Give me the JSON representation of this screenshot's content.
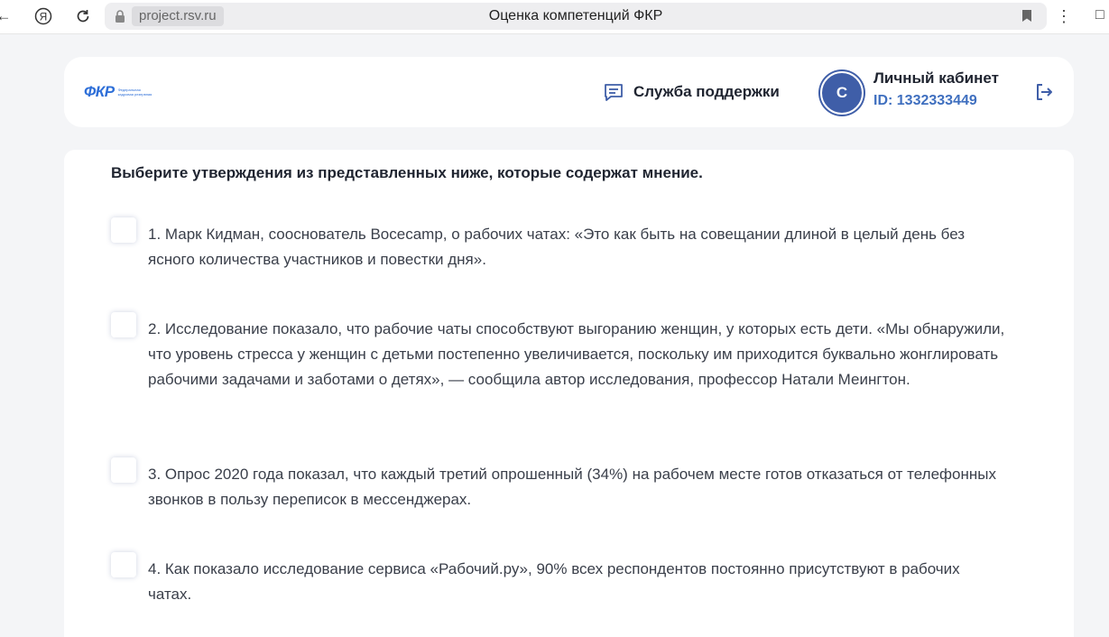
{
  "browser": {
    "url": "project.rsv.ru",
    "tab_title": "Оценка компетенций ФКР",
    "back_icon": "back-arrow-icon",
    "yandex_icon": "yandex-icon",
    "reload_icon": "reload-icon",
    "menu_icon": "kebab-menu-icon"
  },
  "header": {
    "logo_text": "ФКР",
    "logo_sub": "Федеральная кадровая резервная",
    "support_label": "Служба поддержки",
    "avatar_letter": "С",
    "cabinet_title": "Личный кабинет",
    "cabinet_id": "ID: 1332333449"
  },
  "task": {
    "question": "Выберите утверждения из представленных ниже, которые содержат мнение.",
    "options": [
      {
        "text": "1. Марк Кидман, сооснователь Bocecamp, о рабочих чатах: «Это как быть на совещании длиной в целый день без ясного количества участников и повестки дня».",
        "checked": false
      },
      {
        "text": "2. Исследование показало, что рабочие чаты способствуют выгоранию женщин, у которых есть дети. «Мы обнаружили, что уровень стресса у женщин с детьми постепенно увеличивается, поскольку им приходится буквально жонглировать рабочими задачами и заботами о детях», — сообщила автор исследования, профессор Натали Меингтон.",
        "checked": false
      },
      {
        "text": "3. Опрос 2020 года показал, что каждый третий опрошенный (34%) на рабочем месте готов отказаться от телефонных звонков в пользу переписок в мессенджерах.",
        "checked": false
      },
      {
        "text": "4. Как показало исследование сервиса «Рабочий.ру», 90% всех респондентов постоянно присутствуют в рабочих чатах.",
        "checked": false
      }
    ]
  },
  "colors": {
    "accent": "#3f5ea8",
    "id_blue": "#3f6fbf",
    "logo_blue": "#2e6fd8",
    "page_bg": "#f4f5f7"
  }
}
